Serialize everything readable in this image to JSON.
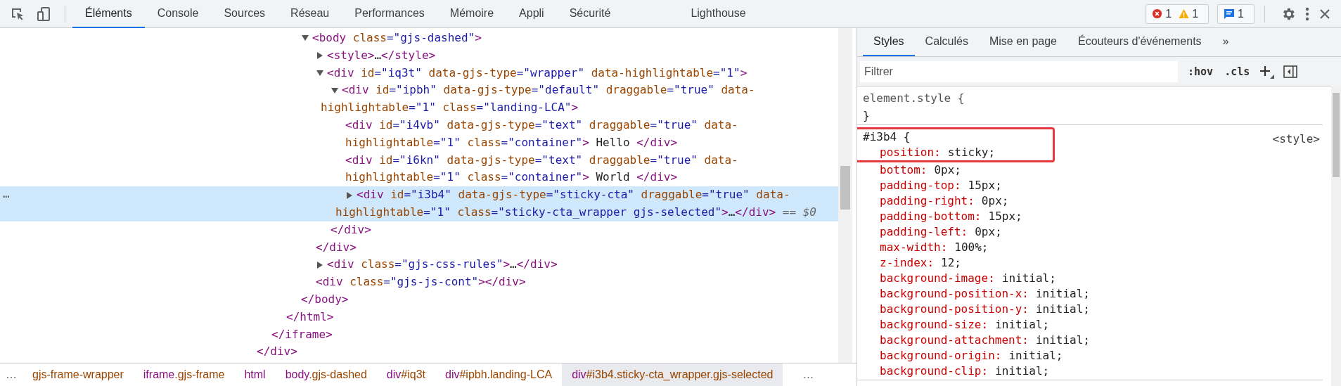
{
  "toolbar": {
    "tabs": [
      {
        "label": "Éléments",
        "selected": true
      },
      {
        "label": "Console",
        "selected": false
      },
      {
        "label": "Sources",
        "selected": false
      },
      {
        "label": "Réseau",
        "selected": false
      },
      {
        "label": "Performances",
        "selected": false
      },
      {
        "label": "Mémoire",
        "selected": false
      },
      {
        "label": "Appli",
        "selected": false
      },
      {
        "label": "Sécurité",
        "selected": false
      },
      {
        "label": "Lighthouse",
        "selected": false
      }
    ],
    "errors": "1",
    "warnings": "1",
    "messages": "1"
  },
  "dom": [
    {
      "children": [
        {
          "children": [
            {
              "children": [
                {
                  "expanded": true,
                  "selected": false,
                  "lines": [
                    [
                      {
                        "kind": "tag",
                        "text": "<body"
                      },
                      {
                        "kind": "attr",
                        "text": " class"
                      },
                      {
                        "kind": "value",
                        "text": "=\"gjs-dashed\""
                      },
                      {
                        "kind": "tag",
                        "text": ">"
                      }
                    ]
                  ],
                  "children": [
                    {
                      "expanded": false,
                      "selected": false,
                      "lines": [
                        [
                          {
                            "kind": "tag",
                            "text": "<style>"
                          },
                          {
                            "kind": "text",
                            "text": "…"
                          },
                          {
                            "kind": "tag",
                            "text": "</style>"
                          }
                        ]
                      ]
                    },
                    {
                      "expanded": true,
                      "selected": false,
                      "lines": [
                        [
                          {
                            "kind": "tag",
                            "text": "<div"
                          },
                          {
                            "kind": "attr",
                            "text": " id"
                          },
                          {
                            "kind": "value",
                            "text": "=\"iq3t\""
                          },
                          {
                            "kind": "attr",
                            "text": " data-gjs-type"
                          },
                          {
                            "kind": "value",
                            "text": "=\"wrapper\""
                          },
                          {
                            "kind": "attr",
                            "text": " data-highlightable"
                          },
                          {
                            "kind": "value",
                            "text": "=\"1\""
                          },
                          {
                            "kind": "tag",
                            "text": ">"
                          }
                        ]
                      ],
                      "children": [
                        {
                          "expanded": true,
                          "selected": false,
                          "lines": [
                            [
                              {
                                "kind": "tag",
                                "text": "<div"
                              },
                              {
                                "kind": "attr",
                                "text": " id"
                              },
                              {
                                "kind": "value",
                                "text": "=\"ipbh\""
                              },
                              {
                                "kind": "attr",
                                "text": " data-gjs-type"
                              },
                              {
                                "kind": "value",
                                "text": "=\"default\""
                              },
                              {
                                "kind": "attr",
                                "text": " draggable"
                              },
                              {
                                "kind": "value",
                                "text": "=\"true\""
                              },
                              {
                                "kind": "attr",
                                "text": " data-"
                              }
                            ],
                            [
                              {
                                "kind": "attr",
                                "text": "highlightable"
                              },
                              {
                                "kind": "value",
                                "text": "=\"1\""
                              },
                              {
                                "kind": "attr",
                                "text": " class"
                              },
                              {
                                "kind": "value",
                                "text": "=\"landing-LCA\""
                              },
                              {
                                "kind": "tag",
                                "text": ">"
                              }
                            ]
                          ],
                          "children": [
                            {
                              "selected": false,
                              "lines": [
                                [
                                  {
                                    "kind": "tag",
                                    "text": "<div"
                                  },
                                  {
                                    "kind": "attr",
                                    "text": " id"
                                  },
                                  {
                                    "kind": "value",
                                    "text": "=\"i4vb\""
                                  },
                                  {
                                    "kind": "attr",
                                    "text": " data-gjs-type"
                                  },
                                  {
                                    "kind": "value",
                                    "text": "=\"text\""
                                  },
                                  {
                                    "kind": "attr",
                                    "text": " draggable"
                                  },
                                  {
                                    "kind": "value",
                                    "text": "=\"true\""
                                  },
                                  {
                                    "kind": "attr",
                                    "text": " data-"
                                  }
                                ],
                                [
                                  {
                                    "kind": "attr",
                                    "text": "highlightable"
                                  },
                                  {
                                    "kind": "value",
                                    "text": "=\"1\""
                                  },
                                  {
                                    "kind": "attr",
                                    "text": " class"
                                  },
                                  {
                                    "kind": "value",
                                    "text": "=\"container\""
                                  },
                                  {
                                    "kind": "tag",
                                    "text": ">"
                                  },
                                  {
                                    "kind": "text",
                                    "text": " Hello "
                                  },
                                  {
                                    "kind": "tag",
                                    "text": "</div>"
                                  }
                                ]
                              ]
                            },
                            {
                              "selected": false,
                              "lines": [
                                [
                                  {
                                    "kind": "tag",
                                    "text": "<div"
                                  },
                                  {
                                    "kind": "attr",
                                    "text": " id"
                                  },
                                  {
                                    "kind": "value",
                                    "text": "=\"i6kn\""
                                  },
                                  {
                                    "kind": "attr",
                                    "text": " data-gjs-type"
                                  },
                                  {
                                    "kind": "value",
                                    "text": "=\"text\""
                                  },
                                  {
                                    "kind": "attr",
                                    "text": " draggable"
                                  },
                                  {
                                    "kind": "value",
                                    "text": "=\"true\""
                                  },
                                  {
                                    "kind": "attr",
                                    "text": " data-"
                                  }
                                ],
                                [
                                  {
                                    "kind": "attr",
                                    "text": "highlightable"
                                  },
                                  {
                                    "kind": "value",
                                    "text": "=\"1\""
                                  },
                                  {
                                    "kind": "attr",
                                    "text": " class"
                                  },
                                  {
                                    "kind": "value",
                                    "text": "=\"container\""
                                  },
                                  {
                                    "kind": "tag",
                                    "text": ">"
                                  },
                                  {
                                    "kind": "text",
                                    "text": " World "
                                  },
                                  {
                                    "kind": "tag",
                                    "text": "</div>"
                                  }
                                ]
                              ]
                            },
                            {
                              "expanded": false,
                              "selected": true,
                              "gutter": "…",
                              "lines": [
                                [
                                  {
                                    "kind": "tag",
                                    "text": "<div"
                                  },
                                  {
                                    "kind": "attr",
                                    "text": " id"
                                  },
                                  {
                                    "kind": "value",
                                    "text": "=\"i3b4\""
                                  },
                                  {
                                    "kind": "attr",
                                    "text": " data-gjs-type"
                                  },
                                  {
                                    "kind": "value",
                                    "text": "=\"sticky-cta\""
                                  },
                                  {
                                    "kind": "attr",
                                    "text": " draggable"
                                  },
                                  {
                                    "kind": "value",
                                    "text": "=\"true\""
                                  },
                                  {
                                    "kind": "attr",
                                    "text": " data-"
                                  }
                                ],
                                [
                                  {
                                    "kind": "attr",
                                    "text": "highlightable"
                                  },
                                  {
                                    "kind": "value",
                                    "text": "=\"1\""
                                  },
                                  {
                                    "kind": "attr",
                                    "text": " class"
                                  },
                                  {
                                    "kind": "value",
                                    "text": "=\"sticky-cta_wrapper gjs-selected\""
                                  },
                                  {
                                    "kind": "tag",
                                    "text": ">"
                                  },
                                  {
                                    "kind": "text",
                                    "text": "…"
                                  },
                                  {
                                    "kind": "tag",
                                    "text": "</div>"
                                  },
                                  {
                                    "kind": "hint",
                                    "text": " == $0"
                                  }
                                ]
                              ]
                            }
                          ],
                          "close": [
                            {
                              "kind": "tag",
                              "text": "</div>"
                            }
                          ]
                        }
                      ],
                      "close": [
                        {
                          "kind": "tag",
                          "text": "</div>"
                        }
                      ]
                    },
                    {
                      "expanded": false,
                      "selected": false,
                      "lines": [
                        [
                          {
                            "kind": "tag",
                            "text": "<div"
                          },
                          {
                            "kind": "attr",
                            "text": " class"
                          },
                          {
                            "kind": "value",
                            "text": "=\"gjs-css-rules\""
                          },
                          {
                            "kind": "tag",
                            "text": ">"
                          },
                          {
                            "kind": "text",
                            "text": "…"
                          },
                          {
                            "kind": "tag",
                            "text": "</div>"
                          }
                        ]
                      ]
                    },
                    {
                      "selected": false,
                      "lines": [
                        [
                          {
                            "kind": "tag",
                            "text": "<div"
                          },
                          {
                            "kind": "attr",
                            "text": " class"
                          },
                          {
                            "kind": "value",
                            "text": "=\"gjs-js-cont\""
                          },
                          {
                            "kind": "tag",
                            "text": ">"
                          },
                          {
                            "kind": "tag",
                            "text": "</div>"
                          }
                        ]
                      ]
                    }
                  ],
                  "close": [
                    {
                      "kind": "tag",
                      "text": "</body>"
                    }
                  ]
                }
              ],
              "close": [
                {
                  "kind": "tag",
                  "text": "</html>"
                }
              ]
            }
          ],
          "close": [
            {
              "kind": "tag",
              "text": "</iframe>"
            }
          ]
        }
      ],
      "close": [
        {
          "kind": "tag",
          "text": "</div>"
        }
      ]
    }
  ],
  "breadcrumbs": [
    {
      "rest": "gjs-frame-wrapper",
      "selected": false
    },
    {
      "tag": "iframe",
      "rest": ".gjs-frame",
      "selected": false
    },
    {
      "tag": "html",
      "selected": false
    },
    {
      "tag": "body",
      "rest": ".gjs-dashed",
      "selected": false
    },
    {
      "tag": "div",
      "rest": "#iq3t",
      "selected": false
    },
    {
      "tag": "div",
      "rest": "#ipbh.landing-LCA",
      "selected": false
    },
    {
      "tag": "div",
      "rest": "#i3b4.sticky-cta_wrapper.gjs-selected",
      "selected": true
    }
  ],
  "breadcrumb_more_left": "…",
  "breadcrumb_more_right": "…",
  "styles": {
    "tabs": [
      {
        "label": "Styles",
        "selected": true
      },
      {
        "label": "Calculés",
        "selected": false
      },
      {
        "label": "Mise en page",
        "selected": false
      },
      {
        "label": "Écouteurs d'événements",
        "selected": false
      }
    ],
    "more_tabs": "»",
    "filter": {
      "placeholder": "Filtrer"
    },
    "hov": ":hov",
    "cls": ".cls",
    "rules": [
      {
        "kind": "inline",
        "selector": "element.style {",
        "close": "}",
        "highlighted": false
      },
      {
        "kind": "matched",
        "selector": "#i3b4 {",
        "source": "<style>",
        "highlighted": true,
        "properties": [
          {
            "name": "position:",
            "value": "sticky;"
          },
          {
            "name": "bottom:",
            "value": "0px;"
          },
          {
            "name": "padding-top:",
            "value": "15px;"
          },
          {
            "name": "padding-right:",
            "value": "0px;"
          },
          {
            "name": "padding-bottom:",
            "value": "15px;"
          },
          {
            "name": "padding-left:",
            "value": "0px;"
          },
          {
            "name": "max-width:",
            "value": "100%;"
          },
          {
            "name": "z-index:",
            "value": "12;"
          },
          {
            "name": "background-image:",
            "value": "initial;"
          },
          {
            "name": "background-position-x:",
            "value": "initial;"
          },
          {
            "name": "background-position-y:",
            "value": "initial;"
          },
          {
            "name": "background-size:",
            "value": "initial;"
          },
          {
            "name": "background-attachment:",
            "value": "initial;"
          },
          {
            "name": "background-origin:",
            "value": "initial;"
          },
          {
            "name": "background-clip:",
            "value": "initial;"
          }
        ]
      }
    ]
  }
}
